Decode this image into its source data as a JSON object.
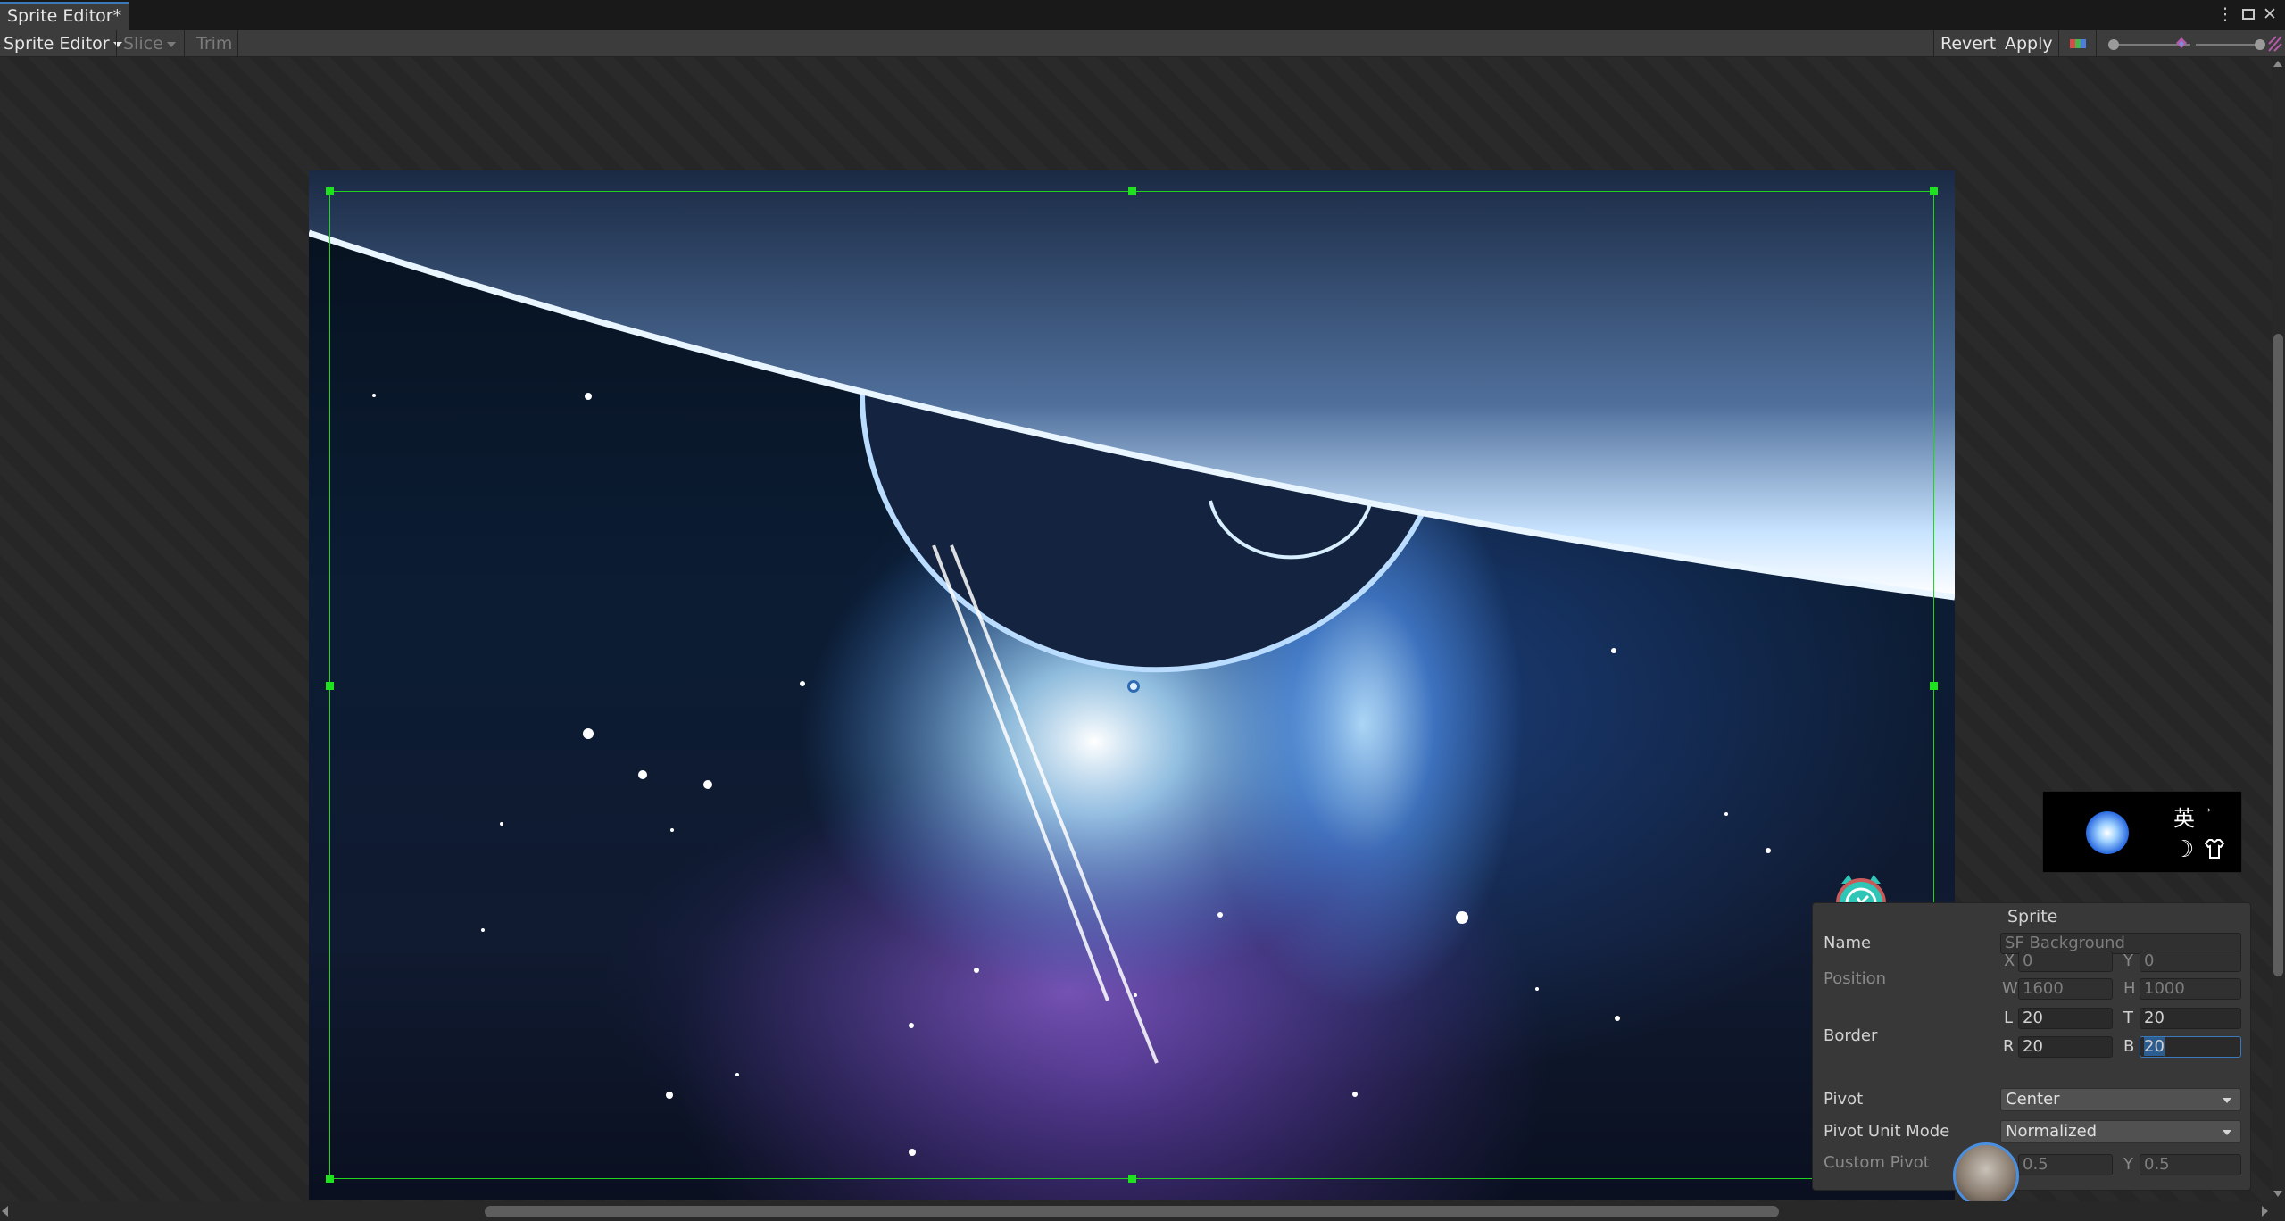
{
  "window": {
    "tab_title": "Sprite Editor*",
    "controls": [
      "more-icon",
      "maximize-icon",
      "close-icon"
    ]
  },
  "toolbar": {
    "mode_label": "Sprite Editor",
    "slice_label": "Slice",
    "trim_label": "Trim",
    "revert_label": "Revert",
    "apply_label": "Apply",
    "zoom_level": 0.95,
    "mip_level": 1.0
  },
  "inspector": {
    "title": "Sprite",
    "name_label": "Name",
    "name_value": "SF Background",
    "position_label": "Position",
    "x_label": "X",
    "x_value": "0",
    "y_label": "Y",
    "y_value": "0",
    "w_label": "W",
    "w_value": "1600",
    "h_label": "H",
    "h_value": "1000",
    "border_label": "Border",
    "l_label": "L",
    "l_value": "20",
    "t_label": "T",
    "t_value": "20",
    "r_label": "R",
    "r_value": "20",
    "b_label": "B",
    "b_value": "20",
    "pivot_label": "Pivot",
    "pivot_value": "Center",
    "pivot_unit_label": "Pivot Unit Mode",
    "pivot_unit_value": "Normalized",
    "custom_pivot_label": "Custom Pivot",
    "custom_x_label": "X",
    "custom_x_value": "0.5",
    "custom_y_label": "Y",
    "custom_y_value": "0.5"
  },
  "ime_widget": {
    "lang_char": "英"
  },
  "colors": {
    "border_lines": "#00ff00",
    "accent": "#3a79bb"
  }
}
